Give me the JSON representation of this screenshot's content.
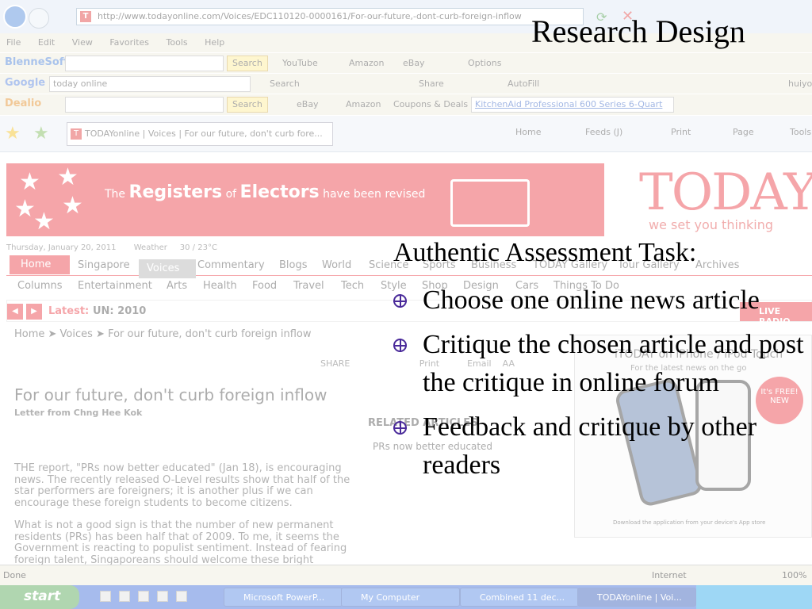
{
  "browser": {
    "url": "http://www.todayonline.com/Voices/EDC110120-0000161/For-our-future,-dont-curb-foreign-inflow",
    "menu": [
      "File",
      "Edit",
      "View",
      "Favorites",
      "Tools",
      "Help"
    ],
    "toolbar1": {
      "brand": "BlenneSoft",
      "search": "Search",
      "youtube": "YouTube",
      "amazon": "Amazon",
      "ebay": "eBay",
      "options": "Options"
    },
    "toolbar2": {
      "brand": "Google",
      "query": "today online",
      "search": "Search",
      "share": "Share",
      "autofill": "AutoFill",
      "user": "huiyo"
    },
    "toolbar3": {
      "brand": "Dealio",
      "search": "Search",
      "ebay": "eBay",
      "amazon": "Amazon",
      "coupons": "Coupons & Deals",
      "deal_link": "KitchenAid Professional 600 Series 6-Quart"
    },
    "tab_title": "TODAYonline | Voices | For our future, don't curb fore...",
    "commands": {
      "home": "Home",
      "feeds": "Feeds (J)",
      "print": "Print",
      "page": "Page",
      "tools": "Tools"
    }
  },
  "website": {
    "banner": {
      "the": "The",
      "registers": "Registers",
      "of": "of",
      "electors": "Electors",
      "rest": "have been revised"
    },
    "logo": "TODAY",
    "tagline": "we set you thinking",
    "date": "Thursday, January 20, 2011",
    "weather_label": "Weather",
    "weather_value": "30 / 23°C",
    "nav": [
      "Home",
      "Singapore",
      "Voices",
      "Commentary",
      "Blogs",
      "World",
      "Science",
      "Sports",
      "Business",
      "TODAY Gallery",
      "Tour Gallery",
      "Archives"
    ],
    "subnav": [
      "Columns",
      "Entertainment",
      "Arts",
      "Health",
      "Food",
      "Travel",
      "Tech",
      "Style",
      "Shop",
      "Design",
      "Cars",
      "Things To Do"
    ],
    "latest_label": "Latest:",
    "latest_value": "UN: 2010",
    "live_radio": "LIVE RADIO",
    "breadcrumb": "Home ➤ Voices ➤ For our future, don't curb foreign inflow",
    "share": "SHARE",
    "print": "Print",
    "email": "Email",
    "font_size": "AA",
    "headline": "For our future, don't curb foreign inflow",
    "byline": "Letter from Chng Hee Kok",
    "related_label": "RELATED ARTICLES",
    "related_item": "PRs now better educated",
    "para1": "THE report, \"PRs now better educated\" (Jan 18), is encouraging news. The recently released O-Level results show that half of the star performers are foreigners; it is another plus if we can encourage these foreign students to become citizens.",
    "para2": "What is not a good sign is that the number of new permanent residents (PRs) has been half that of 2009. To me, it seems the Government is reacting to populist sentiment. Instead of fearing foreign talent, Singaporeans should welcome these bright",
    "promo_title": "iTODAY on iPhone / iPod Touch",
    "promo_sub": "For the latest news on the go",
    "promo_badge": "It's FREE! NEW",
    "promo_foot": "Download the application from your device's App store"
  },
  "status": {
    "left": "Done",
    "zone": "Internet",
    "zoom": "100%"
  },
  "taskbar": {
    "start": "start",
    "tasks": [
      "Microsoft PowerP...",
      "My Computer",
      "Combined 11 dec...",
      "TODAYonline | Voi..."
    ]
  },
  "slide": {
    "title": "Research Design",
    "subhead": "Authentic Assessment Task:",
    "bullets": [
      "Choose one online news article",
      "Critique the chosen article and post the critique in online forum",
      "Feedback and critique by other readers"
    ],
    "bullet_color": "#4a2a9a"
  }
}
